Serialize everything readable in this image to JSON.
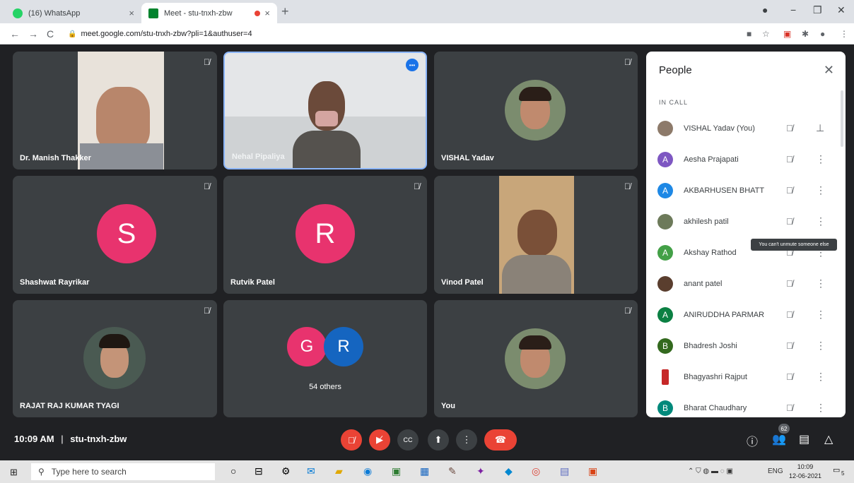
{
  "browser": {
    "tabs": [
      {
        "label": "(16) WhatsApp",
        "close": "×"
      },
      {
        "label": "Meet - stu-tnxh-zbw",
        "close": "×"
      }
    ],
    "new_tab": "+",
    "url": "meet.google.com/stu-tnxh-zbw?pli=1&authuser=4"
  },
  "tiles": [
    {
      "name": "Dr. Manish Thakker"
    },
    {
      "name": "Nehal Pipaliya"
    },
    {
      "name": "VISHAL Yadav"
    },
    {
      "name": "Shashwat Rayrikar",
      "initial": "S"
    },
    {
      "name": "Rutvik Patel",
      "initial": "R"
    },
    {
      "name": "Vinod Patel"
    },
    {
      "name": "RAJAT RAJ KUMAR TYAGI"
    },
    {
      "name": "54 others",
      "initials": [
        "G",
        "R"
      ]
    },
    {
      "name": "You"
    }
  ],
  "people": {
    "title": "People",
    "section": "IN CALL",
    "list": [
      {
        "name": "VISHAL Yadav (You)",
        "initial": ""
      },
      {
        "name": "Aesha Prajapati",
        "initial": "A"
      },
      {
        "name": "AKBARHUSEN BHATT",
        "initial": "A"
      },
      {
        "name": "akhilesh patil",
        "initial": ""
      },
      {
        "name": "Akshay Rathod",
        "initial": "A"
      },
      {
        "name": "anant patel",
        "initial": ""
      },
      {
        "name": "ANIRUDDHA PARMAR",
        "initial": "A"
      },
      {
        "name": "Bhadresh Joshi",
        "initial": "B"
      },
      {
        "name": "Bhagyashri Rajput",
        "initial": ""
      },
      {
        "name": "Bharat Chaudhary",
        "initial": "B"
      }
    ],
    "tooltip": "You can't unmute someone else"
  },
  "bottom": {
    "time": "10:09 AM",
    "separator": "|",
    "meeting_code": "stu-tnxh-zbw",
    "people_count": "62"
  },
  "taskbar": {
    "search_placeholder": "Type here to search",
    "lang": "ENG",
    "time": "10:09",
    "date": "12-06-2021",
    "notif_count": "5"
  },
  "colors": {
    "accent_pink": "#e8336e",
    "accent_blue": "#1a73e8",
    "end_red": "#ea4335",
    "purple": "#7e57c2",
    "green": "#0b8043",
    "teal": "#1e88e5",
    "dark_green": "#33691e"
  }
}
